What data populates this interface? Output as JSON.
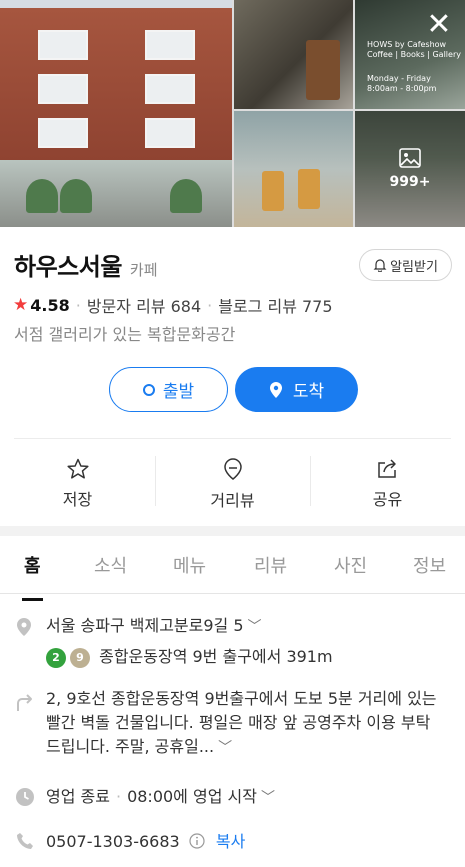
{
  "gallery": {
    "sign_lines": [
      "HOWS by Cafeshow",
      "Coffee | Books | Gallery",
      "Monday - Friday",
      "8:00am - 8:00pm"
    ],
    "photo_count": "999+"
  },
  "place": {
    "name": "하우스서울",
    "category": "카페",
    "notify_label": "알림받기",
    "rating": "4.58",
    "visitor_reviews": "방문자 리뷰 684",
    "blog_reviews": "블로그 리뷰 775",
    "description": "서점 갤러리가 있는 복합문화공간"
  },
  "route": {
    "depart_label": "출발",
    "arrive_label": "도착"
  },
  "actions": [
    {
      "label": "저장",
      "icon": "star-outline-icon"
    },
    {
      "label": "거리뷰",
      "icon": "location-pin-icon"
    },
    {
      "label": "공유",
      "icon": "share-icon"
    }
  ],
  "tabs": [
    "홈",
    "소식",
    "메뉴",
    "리뷰",
    "사진",
    "정보"
  ],
  "info": {
    "address": "서울 송파구 백제고분로9길 5",
    "subway_lines": [
      "2",
      "9"
    ],
    "subway_text": "종합운동장역 9번 출구에서 391m",
    "directions": "2, 9호선 종합운동장역 9번출구에서 도보 5분 거리에 있는 빨간 벽돌 건물입니다. 평일은 매장 앞 공영주차 이용 부탁드립니다. 주말, 공휴일...",
    "hours_status": "영업 종료",
    "hours_next": "08:00에 영업 시작",
    "phone": "0507-1303-6683",
    "copy_label": "복사"
  },
  "colors": {
    "accent": "#1a7cf0",
    "star": "#f23c3c",
    "line2": "#33a23d",
    "line9": "#bdb092"
  }
}
